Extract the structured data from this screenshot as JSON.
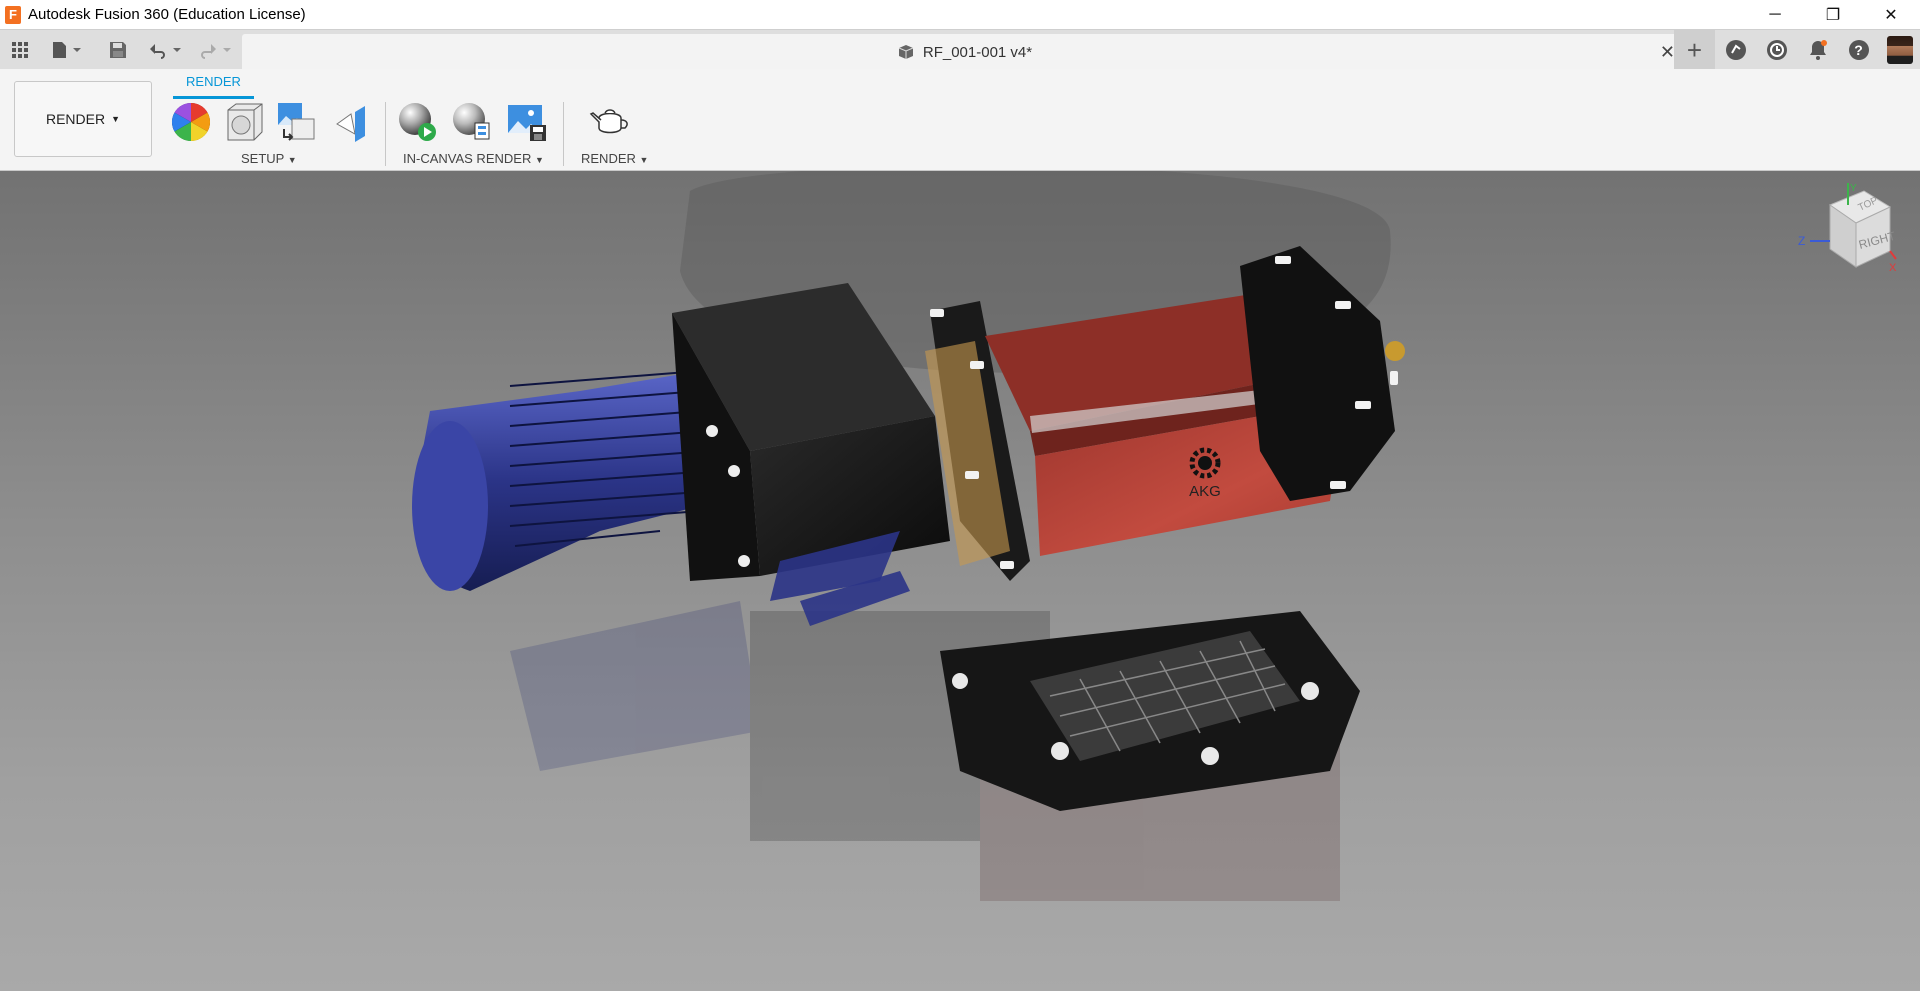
{
  "window": {
    "title": "Autodesk Fusion 360 (Education License)",
    "app_icon_letter": "F",
    "controls": {
      "minimize": "─",
      "restore": "❐",
      "close": "✕"
    }
  },
  "tabbar": {
    "document_title": "RF_001-001 v4*",
    "close_symbol": "✕",
    "new_tab_symbol": "+",
    "help_symbol": "?"
  },
  "toolbar": {
    "workspace_label": "RENDER",
    "active_tab": "RENDER",
    "groups": {
      "setup": "SETUP",
      "in_canvas": "IN-CANVAS RENDER",
      "render": "RENDER"
    }
  },
  "viewport": {
    "logo_text": "AKG",
    "viewcube": {
      "top_face": "TOP",
      "right_face": "RIGHT",
      "axes": {
        "x": "X",
        "y": "Y",
        "z": "Z"
      }
    }
  },
  "colors": {
    "accent": "#0696d7",
    "app_icon": "#f37021",
    "motor_blue": "#2f3a8f",
    "panel_red": "#b8473a",
    "viewport_bg": "#8a8a8a"
  }
}
